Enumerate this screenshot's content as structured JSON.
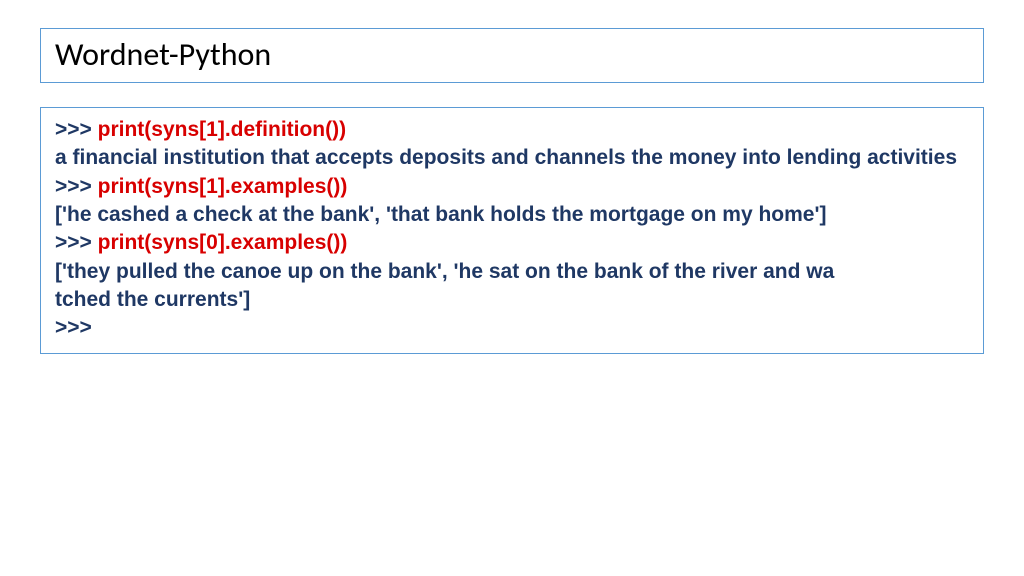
{
  "title": "Wordnet-Python",
  "lines": {
    "p1": ">>> ",
    "c1": "print(syns[1].definition())",
    "o1": "a financial institution that accepts deposits and channels the money into lending activities",
    "p2": ">>> ",
    "c2": "print(syns[1].examples())",
    "o2": "['he cashed a check at the bank', 'that bank holds the mortgage on my home']",
    "p3": ">>> ",
    "c3": "print(syns[0].examples())",
    "o3a": "['they pulled the canoe up on the bank', 'he sat on the bank of the river and wa",
    "o3b": "tched the currents']",
    "p4": ">>>"
  }
}
